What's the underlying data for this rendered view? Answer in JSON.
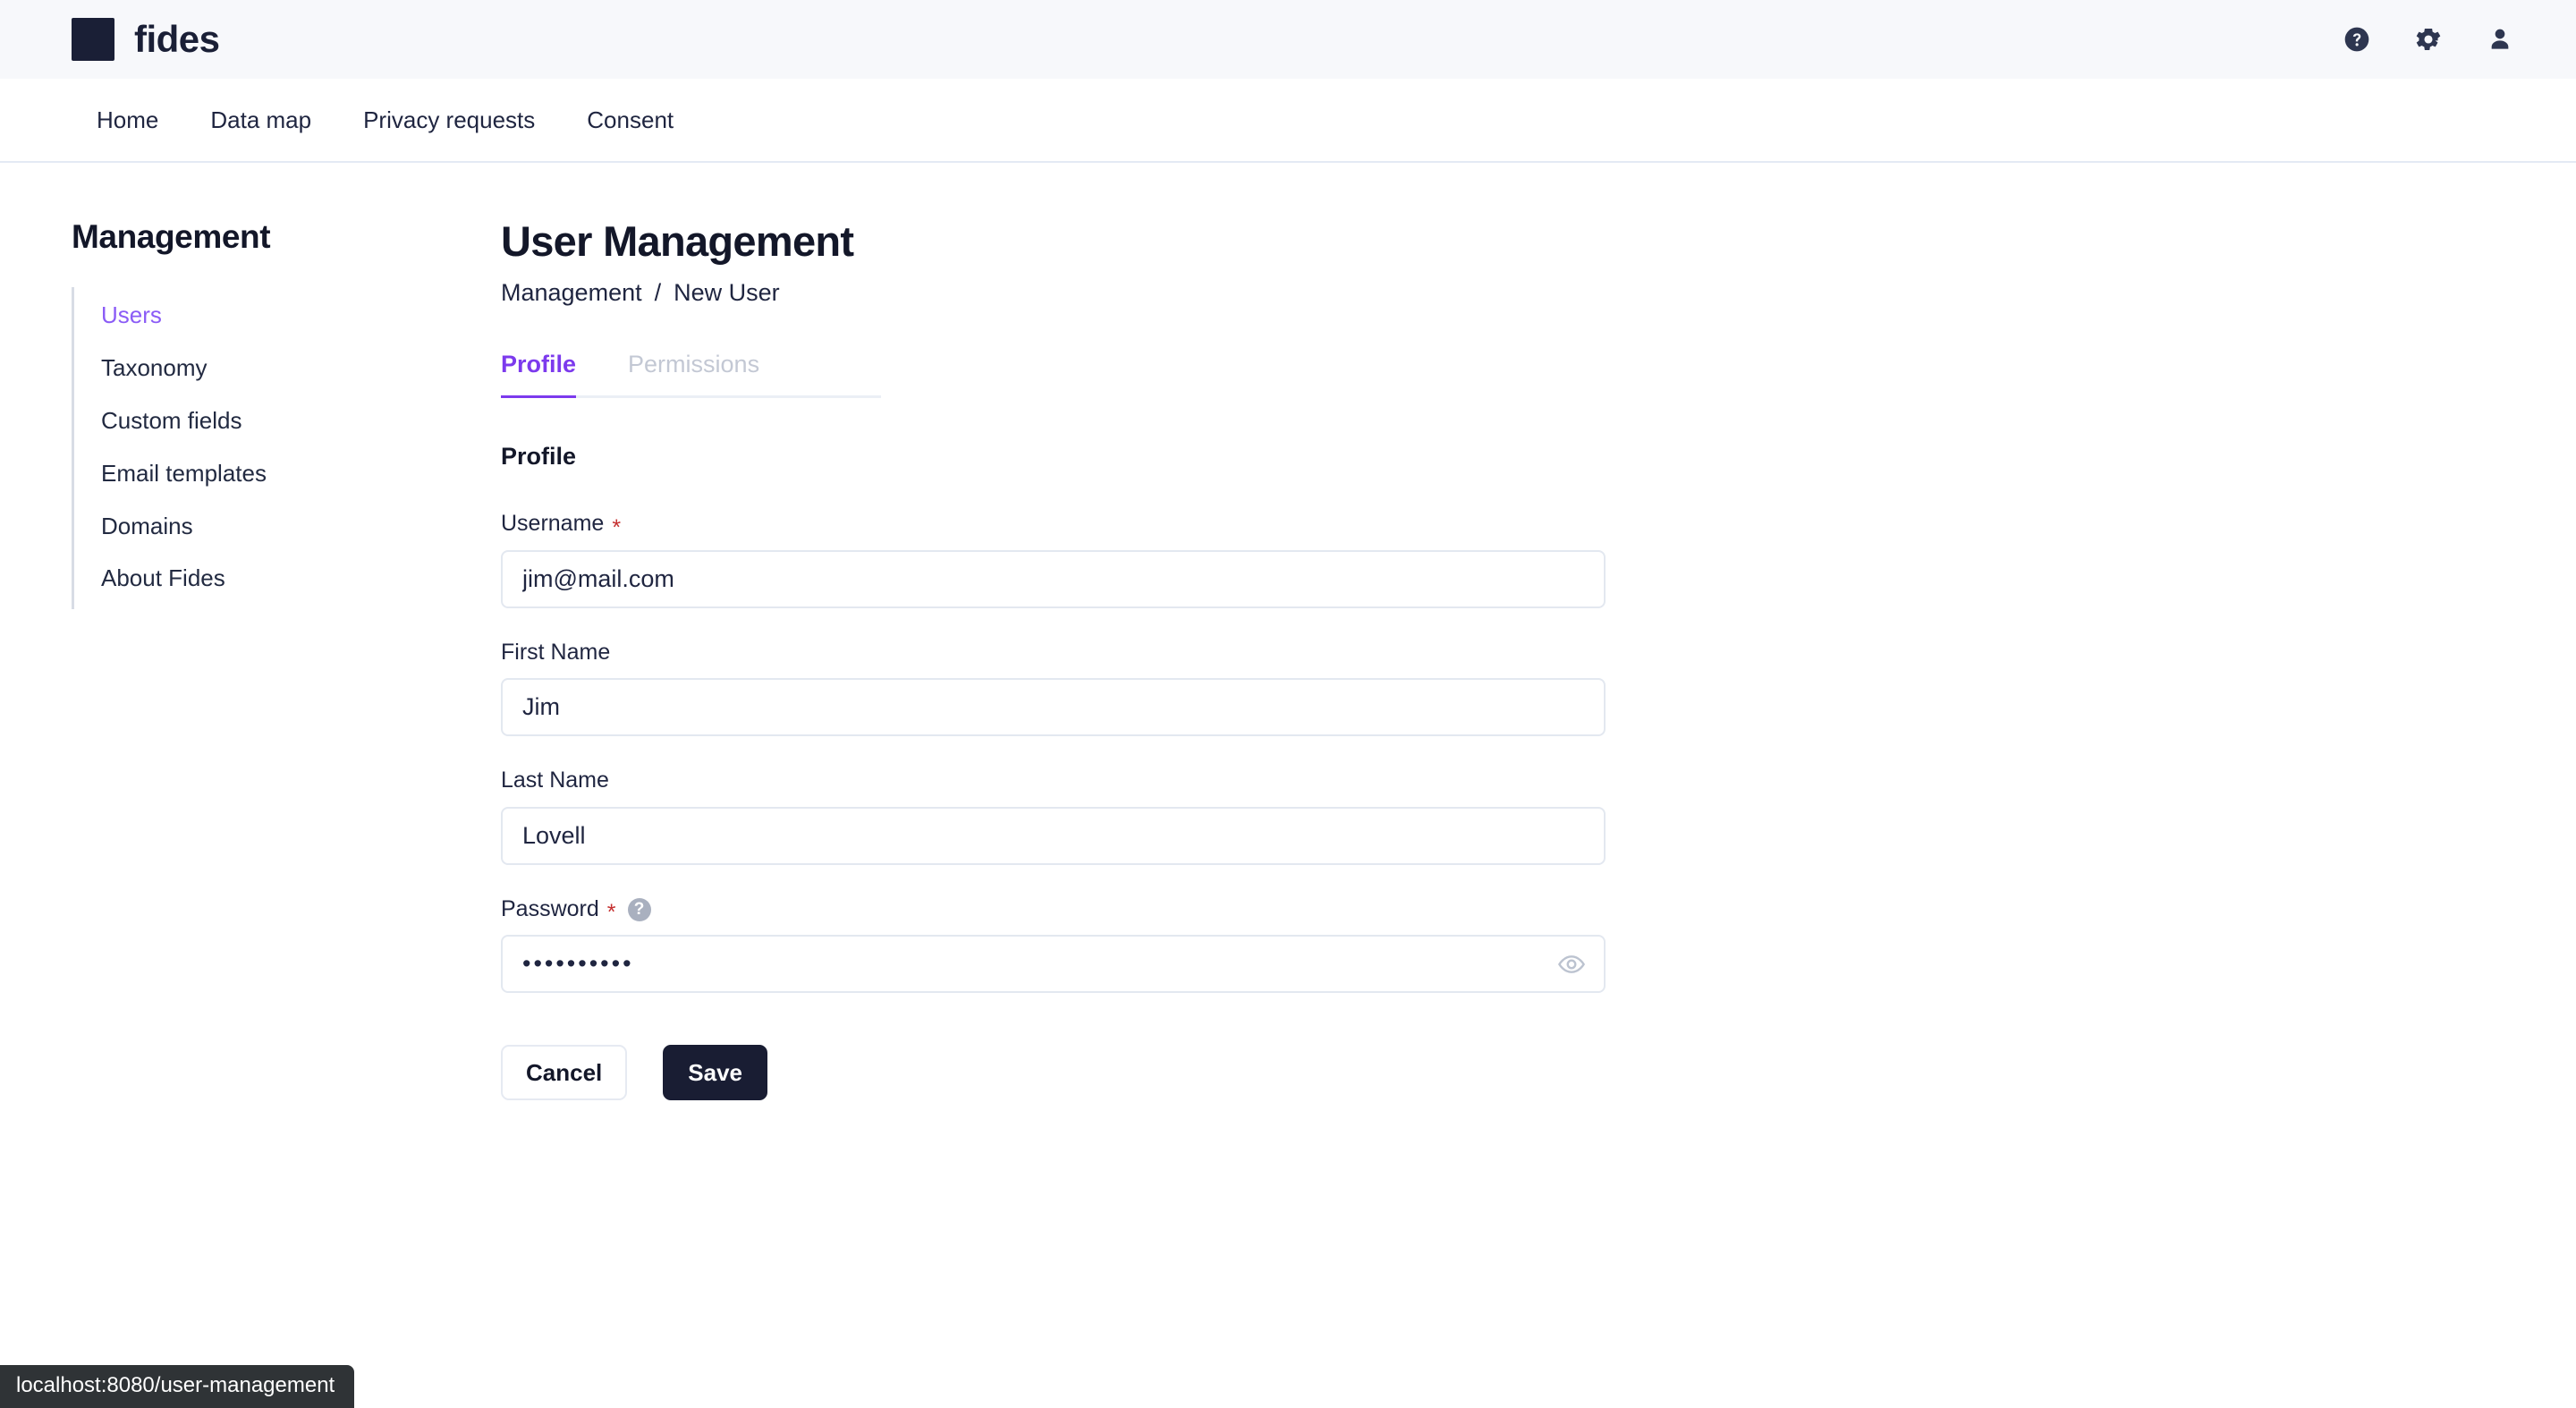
{
  "header": {
    "brand_name": "fides",
    "icons": [
      {
        "name": "help-icon",
        "glyph": "question-circle"
      },
      {
        "name": "settings-icon",
        "glyph": "gear"
      },
      {
        "name": "user-account-icon",
        "glyph": "person"
      }
    ]
  },
  "nav": {
    "items": [
      {
        "label": "Home"
      },
      {
        "label": "Data map"
      },
      {
        "label": "Privacy requests"
      },
      {
        "label": "Consent"
      }
    ]
  },
  "sidebar": {
    "title": "Management",
    "items": [
      {
        "label": "Users",
        "active": true
      },
      {
        "label": "Taxonomy",
        "active": false
      },
      {
        "label": "Custom fields",
        "active": false
      },
      {
        "label": "Email templates",
        "active": false
      },
      {
        "label": "Domains",
        "active": false
      },
      {
        "label": "About Fides",
        "active": false
      }
    ]
  },
  "main": {
    "page_title": "User Management",
    "breadcrumb": {
      "root": "Management",
      "separator": "/",
      "current": "New User"
    },
    "tabs": [
      {
        "label": "Profile",
        "active": true
      },
      {
        "label": "Permissions",
        "active": false
      }
    ],
    "section_heading": "Profile",
    "fields": {
      "username": {
        "label": "Username",
        "required_marker": "*",
        "value": "jim@mail.com",
        "placeholder": ""
      },
      "first_name": {
        "label": "First Name",
        "value": "Jim",
        "placeholder": ""
      },
      "last_name": {
        "label": "Last Name",
        "value": "Lovell",
        "placeholder": ""
      },
      "password": {
        "label": "Password",
        "required_marker": "*",
        "info_glyph": "?",
        "value": "••••••••••",
        "placeholder": ""
      }
    },
    "buttons": {
      "cancel_label": "Cancel",
      "save_label": "Save"
    }
  },
  "status_bar": {
    "url": "localhost:8080/user-management"
  },
  "colors": {
    "accent_purple": "#7c3aed",
    "active_link_purple": "#8b5cf6",
    "brand_dark": "#1a1f36",
    "required_red": "#c53030",
    "header_bg": "#f7f8fb",
    "border_light": "#e3e8f0"
  }
}
